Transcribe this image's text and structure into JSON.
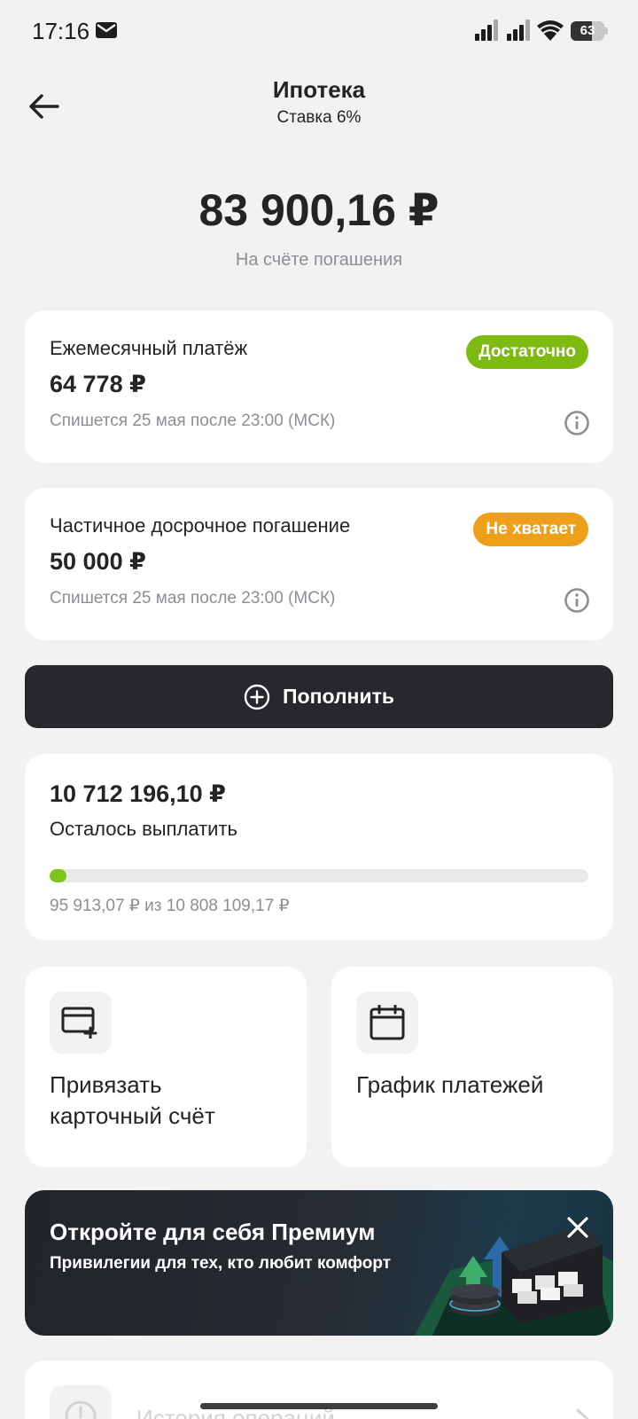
{
  "status_bar": {
    "time": "17:16",
    "battery_level": 63,
    "battery_label": "63",
    "icons": [
      "mail-icon",
      "signal-icon",
      "signal-icon",
      "wifi-icon",
      "battery-icon"
    ]
  },
  "header": {
    "back_icon": "arrow-left-icon",
    "title": "Ипотека",
    "subtitle": "Ставка 6%"
  },
  "balance": {
    "amount": "83 900,16 ₽",
    "caption": "На счёте погашения"
  },
  "payments": [
    {
      "title": "Ежемесячный платёж",
      "amount": "64 778 ₽",
      "note": "Спишется 25 мая после 23:00 (МСК)",
      "badge": "Достаточно",
      "badge_color": "#7dbb11"
    },
    {
      "title": "Частичное досрочное погашение",
      "amount": "50 000 ₽",
      "note": "Спишется 25 мая после 23:00 (МСК)",
      "badge": "Не хватает",
      "badge_color": "#efa019"
    }
  ],
  "topup": {
    "label": "Пополнить",
    "icon": "plus-circle-icon"
  },
  "remaining": {
    "amount": "10 712 196,10 ₽",
    "label": "Осталось выплатить",
    "paid_text": "95 913,07 ₽ из 10 808 109,17 ₽",
    "progress_fraction": 0.0089
  },
  "tiles": [
    {
      "label": "Привязать\nкарточный счёт",
      "icon": "card-plus-icon"
    },
    {
      "label": "График платежей",
      "icon": "calendar-icon"
    }
  ],
  "promo": {
    "title": "Откройте для себя Премиум",
    "subtitle": "Привилегии для тех, кто любит комфорт"
  },
  "history": {
    "label": "История операций",
    "icon": "clock-icon"
  },
  "colors": {
    "accent_green": "#7fc41b",
    "dark_button": "#26282b",
    "background": "#f2f2f3"
  }
}
